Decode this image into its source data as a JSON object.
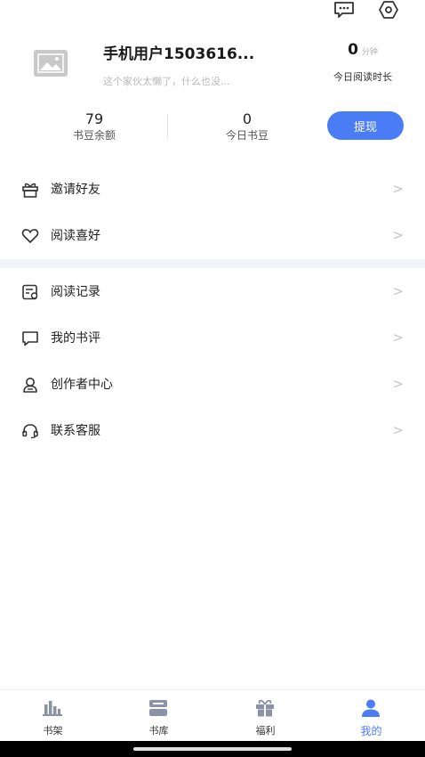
{
  "header": {
    "icons": [
      "message-icon",
      "settings-icon"
    ]
  },
  "profile": {
    "username": "手机用户1503616...",
    "signature": "这个家伙太懒了，什么也没...",
    "read_time_value": "0",
    "read_time_unit": "分钟",
    "read_time_label": "今日阅读时长"
  },
  "stats": {
    "beans_value": "79",
    "beans_label": "书豆余额",
    "today_value": "0",
    "today_label": "今日书豆",
    "withdraw_label": "提现"
  },
  "menu_group1": [
    {
      "label": "邀请好友",
      "icon": "gift-icon",
      "arrow": ">"
    },
    {
      "label": "阅读喜好",
      "icon": "heart-icon",
      "arrow": ">"
    }
  ],
  "menu_group2": [
    {
      "label": "阅读记录",
      "icon": "history-icon",
      "arrow": ">"
    },
    {
      "label": "我的书评",
      "icon": "comment-icon",
      "arrow": ">"
    },
    {
      "label": "创作者中心",
      "icon": "creator-icon",
      "arrow": ">"
    },
    {
      "label": "联系客服",
      "icon": "headset-icon",
      "arrow": ">"
    }
  ],
  "tabbar": {
    "tabs": [
      {
        "label": "书架",
        "icon": "bookshelf-icon",
        "active": false
      },
      {
        "label": "书库",
        "icon": "library-icon",
        "active": false
      },
      {
        "label": "福利",
        "icon": "gift-box-icon",
        "active": false
      },
      {
        "label": "我的",
        "icon": "user-icon",
        "active": true
      }
    ]
  },
  "colors": {
    "accent": "#4a7cf6",
    "section_gap": "#f2f4f7",
    "muted_text": "#b8b8b8"
  }
}
